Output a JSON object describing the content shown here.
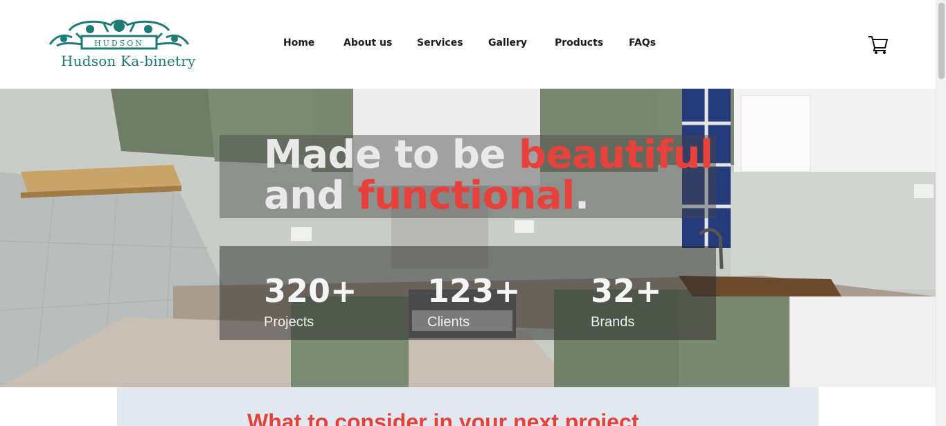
{
  "brand": {
    "name": "Hudson Ka-binetry",
    "plate_text": "HUDSON",
    "color": "#1e7b76"
  },
  "nav": {
    "items": [
      {
        "label": "Home"
      },
      {
        "label": "About us"
      },
      {
        "label": "Services"
      },
      {
        "label": "Gallery"
      },
      {
        "label": "Products"
      },
      {
        "label": "FAQs"
      }
    ]
  },
  "header": {
    "cart_icon": "shopping-cart-icon"
  },
  "hero": {
    "headline_part1": "Made to be ",
    "headline_red1": "beautiful",
    "headline_part2": "and ",
    "headline_red2": "functional",
    "headline_end": ".",
    "accent_color": "#e8403a",
    "stats": [
      {
        "value": "320+",
        "label": "Projects"
      },
      {
        "value": "123+",
        "label": "Clients"
      },
      {
        "value": "32+",
        "label": "Brands"
      }
    ]
  },
  "section": {
    "title": "What to consider in your next project"
  }
}
